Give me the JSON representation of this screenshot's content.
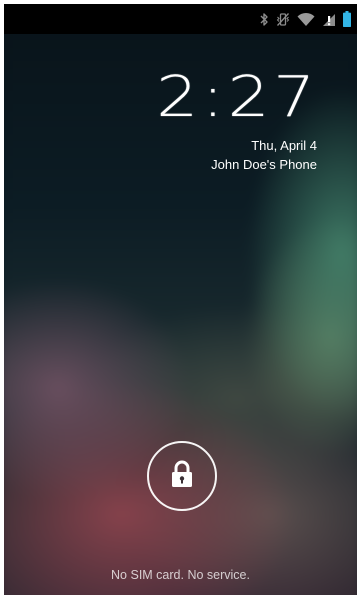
{
  "status_bar": {
    "icons": [
      "bluetooth-icon",
      "vibrate-icon",
      "wifi-icon",
      "no-sim-icon",
      "battery-icon"
    ],
    "accent": "#33b5e5"
  },
  "lockscreen": {
    "time": "2:27",
    "date": "Thu, April 4",
    "owner_info": "John Doe's Phone",
    "unlock_icon": "lock-icon",
    "carrier_text": "No SIM card. No service."
  }
}
